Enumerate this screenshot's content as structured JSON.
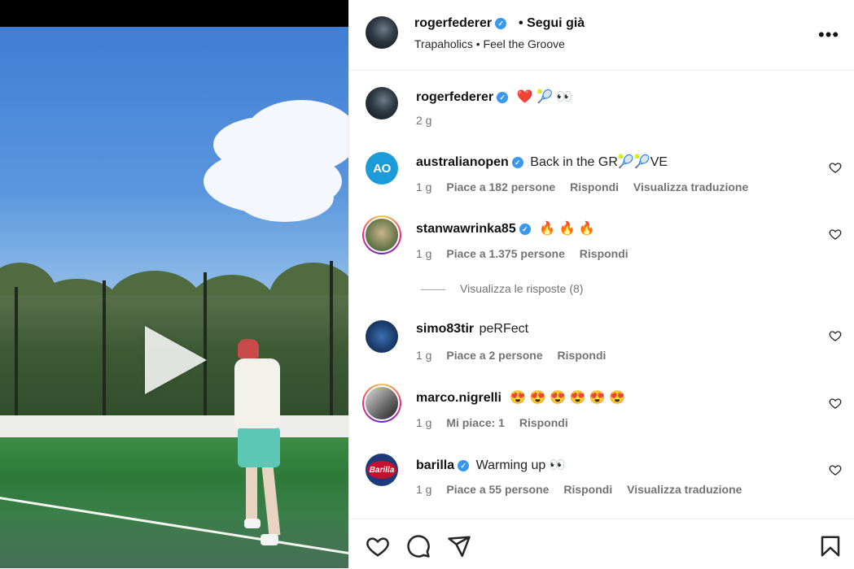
{
  "post": {
    "author": "rogerfederer",
    "follow_sep": "•",
    "follow_status": "Segui già",
    "subtitle": "Trapaholics • Feel the Groove",
    "more_icon": "more-options-icon",
    "caption_emoji": "❤️ 🎾 👀",
    "caption_age": "2 g"
  },
  "comments": [
    {
      "user": "australianopen",
      "verified": true,
      "text": "Back in the GR🎾🎾VE",
      "age": "1 g",
      "likes": "Piace a 182 persone",
      "reply": "Rispondi",
      "translate": "Visualizza traduzione"
    },
    {
      "user": "stanwawrinka85",
      "verified": true,
      "text": "🔥 🔥 🔥",
      "age": "1 g",
      "likes": "Piace a 1.375 persone",
      "reply": "Rispondi",
      "translate": ""
    },
    {
      "user": "simo83tir",
      "verified": false,
      "text": "peRFect",
      "age": "1 g",
      "likes": "Piace a 2 persone",
      "reply": "Rispondi",
      "translate": ""
    },
    {
      "user": "marco.nigrelli",
      "verified": false,
      "text": "😍 😍 😍 😍 😍 😍",
      "age": "1 g",
      "likes": "Mi piace: 1",
      "reply": "Rispondi",
      "translate": ""
    },
    {
      "user": "barilla",
      "verified": true,
      "text": "Warming up 👀",
      "age": "1 g",
      "likes": "Piace a 55 persone",
      "reply": "Rispondi",
      "translate": "Visualizza traduzione"
    }
  ],
  "replies_link": "Visualizza le risposte (8)",
  "avatars": {
    "australianopen": "AO",
    "barilla": "Barilla"
  },
  "actions": {
    "like": "heart-icon",
    "comment": "comment-icon",
    "share": "share-icon",
    "save": "bookmark-icon"
  },
  "colors": {
    "verified": "#3897f0",
    "meta_text": "#737373",
    "ao_brand": "#1b9bd8",
    "barilla_red": "#c8102e"
  }
}
